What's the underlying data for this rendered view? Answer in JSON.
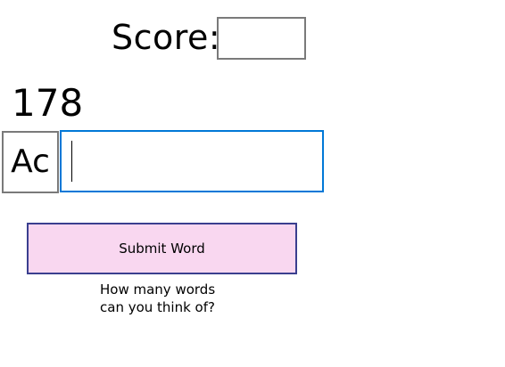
{
  "score": {
    "label": "Score:",
    "value": ""
  },
  "timer": {
    "value": "178"
  },
  "letters": {
    "value": "Ac"
  },
  "word_input": {
    "value": "",
    "placeholder": ""
  },
  "submit": {
    "label": "Submit Word"
  },
  "hint": {
    "text": "How many words can you think of?"
  },
  "colors": {
    "input_focus_border": "#0078d7",
    "button_fill": "#f9d7f0",
    "button_border": "#3a3f8f",
    "box_border": "#7a7a7a"
  }
}
